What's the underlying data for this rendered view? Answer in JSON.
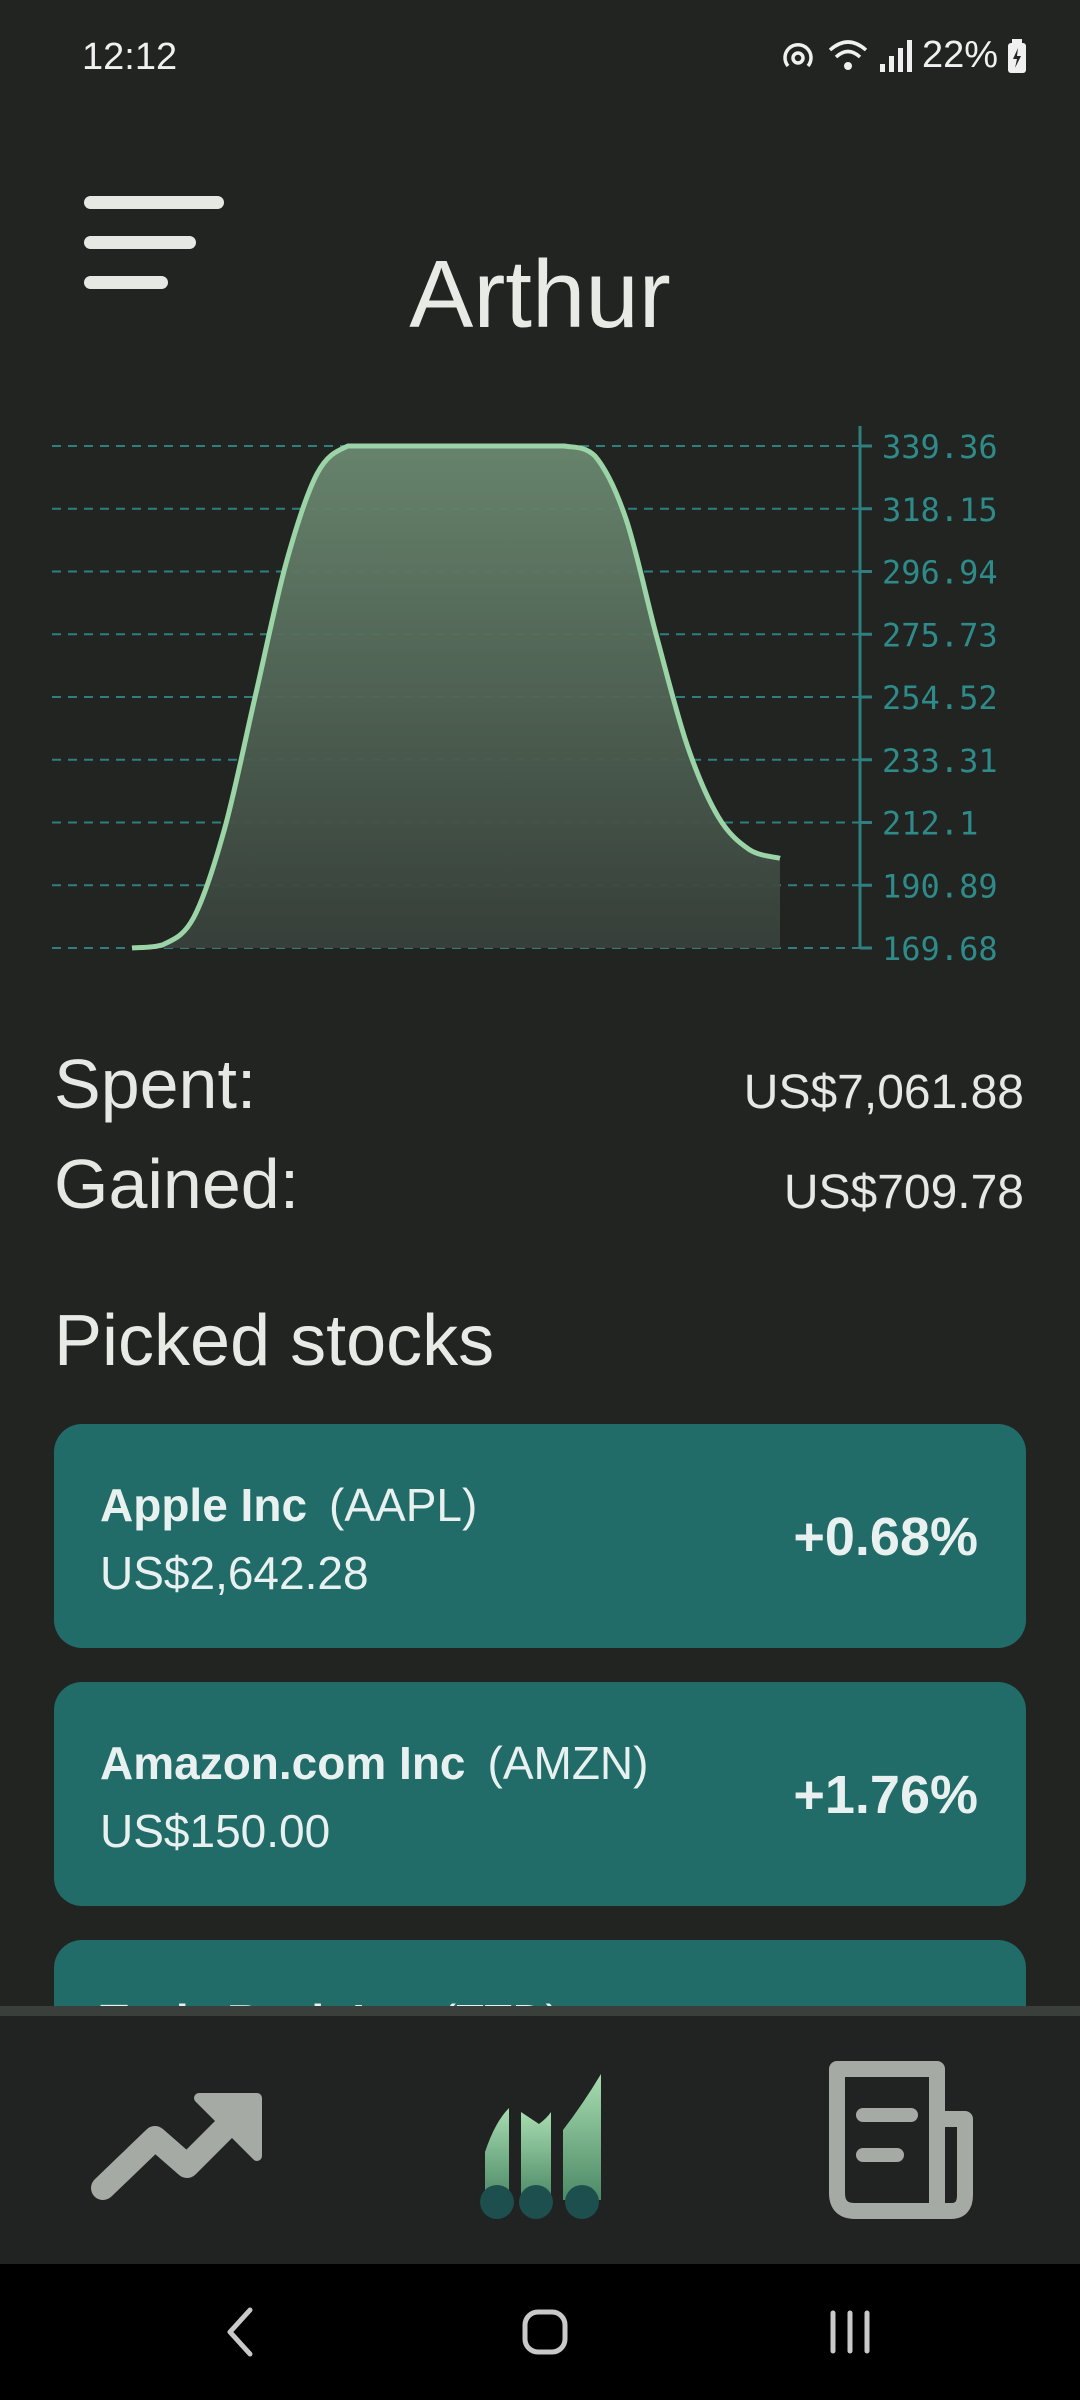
{
  "status_bar": {
    "time": "12:12",
    "battery": "22%"
  },
  "header": {
    "title": "Arthur"
  },
  "chart_data": {
    "type": "area",
    "title": "",
    "xlabel": "",
    "ylabel": "",
    "y_ticks": [
      339.36,
      318.15,
      296.94,
      275.73,
      254.52,
      233.31,
      212.1,
      190.89,
      169.68
    ],
    "ylim": [
      169.68,
      339.36
    ],
    "grid": true,
    "series": [
      {
        "values": [
          169.68,
          170.8,
          180,
          210,
          255,
          300,
          330,
          339.36,
          339.36,
          339.36,
          339.36,
          339.36,
          339.36,
          339.36,
          339.36,
          336,
          315,
          275,
          238,
          214,
          203,
          200
        ]
      }
    ],
    "colors": {
      "line": "#9bd4a6",
      "grid": "#2f7f80",
      "tick_text": "#2f8a8a"
    }
  },
  "summary": {
    "spent_label": "Spent:",
    "spent_value": "US$7,061.88",
    "gained_label": "Gained:",
    "gained_value": "US$709.78"
  },
  "picked": {
    "title": "Picked stocks",
    "stocks": [
      {
        "name": "Apple Inc",
        "ticker": "(AAPL)",
        "price": "US$2,642.28",
        "change": "+0.68%"
      },
      {
        "name": "Amazon.com Inc",
        "ticker": "(AMZN)",
        "price": "US$150.00",
        "change": "+1.76%"
      },
      {
        "name": "Tesla Rech Inc",
        "ticker": "(TTD)",
        "price": "",
        "change": ""
      }
    ]
  },
  "bottom_nav": {
    "items": [
      {
        "icon": "trending-up-icon"
      },
      {
        "icon": "bar-chart-icon"
      },
      {
        "icon": "newspaper-icon"
      }
    ]
  },
  "system_nav": {
    "icons": [
      "back-icon",
      "home-icon",
      "recents-icon"
    ]
  },
  "colors": {
    "background": "#212421",
    "card": "#216b68",
    "accent": "#9bd4a6"
  }
}
